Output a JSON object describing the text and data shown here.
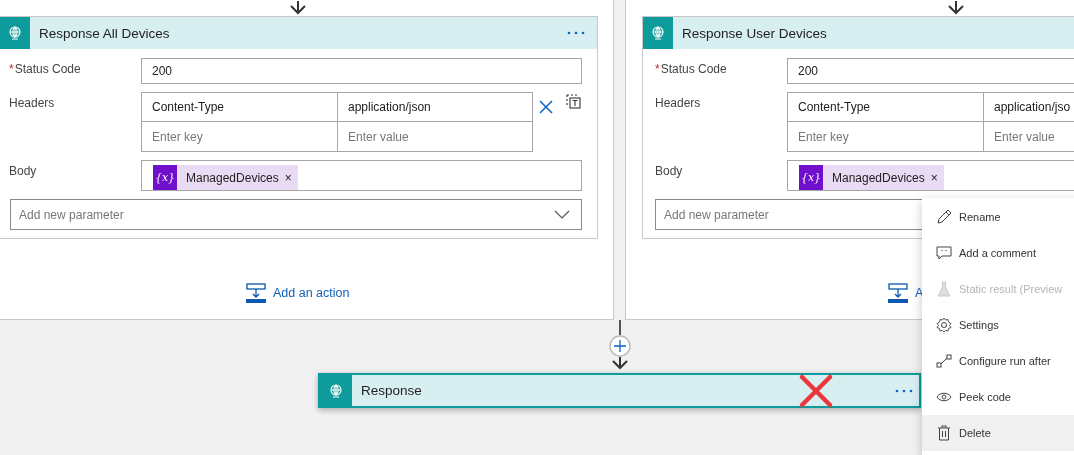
{
  "branches": [
    {
      "title": "Response All Devices",
      "more_button": true,
      "required_mark": "*",
      "status_label": "Status Code",
      "status_value": "200",
      "headers_label": "Headers",
      "header_rows": [
        {
          "key": "Content-Type",
          "value": "application/json"
        }
      ],
      "key_placeholder": "Enter key",
      "value_placeholder": "Enter value",
      "row_actions": true,
      "body_label": "Body",
      "token_icon": "{x}",
      "token": "ManagedDevices",
      "token_remove": "×",
      "parameter_placeholder": "Add new parameter",
      "dropdown_arrow": true,
      "add_action": "Add an action"
    },
    {
      "title": "Response User Devices",
      "more_button": false,
      "required_mark": "*",
      "status_label": "Status Code",
      "status_value": "200",
      "headers_label": "Headers",
      "header_rows": [
        {
          "key": "Content-Type",
          "value": "application/jso"
        }
      ],
      "key_placeholder": "Enter key",
      "value_placeholder": "Enter value",
      "row_actions": false,
      "body_label": "Body",
      "token_icon": "{x}",
      "token": "ManagedDevices",
      "token_remove": "×",
      "parameter_placeholder": "Add new parameter",
      "dropdown_arrow": false,
      "add_action": "A"
    }
  ],
  "action": {
    "title": "Response",
    "selected": true,
    "marked_for_deletion": true
  },
  "menu": [
    {
      "kind": "rename",
      "label": "Rename",
      "disabled": false,
      "highlighted": false
    },
    {
      "kind": "comment",
      "label": "Add a comment",
      "disabled": false,
      "highlighted": false
    },
    {
      "kind": "static",
      "label": "Static result (Preview",
      "disabled": true,
      "highlighted": false
    },
    {
      "kind": "settings",
      "label": "Settings",
      "disabled": false,
      "highlighted": false
    },
    {
      "kind": "runafter",
      "label": "Configure run after",
      "disabled": false,
      "highlighted": false
    },
    {
      "kind": "peek",
      "label": "Peek code",
      "disabled": false,
      "highlighted": false
    },
    {
      "kind": "delete",
      "label": "Delete",
      "disabled": false,
      "highlighted": true
    }
  ]
}
